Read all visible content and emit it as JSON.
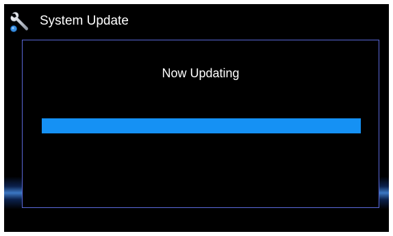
{
  "header": {
    "icon": "wrench-icon",
    "title": "System Update"
  },
  "dialog": {
    "message": "Now Updating",
    "progress": 1.0,
    "accent_color": "#1591f4",
    "border_color": "#5a68d8"
  }
}
